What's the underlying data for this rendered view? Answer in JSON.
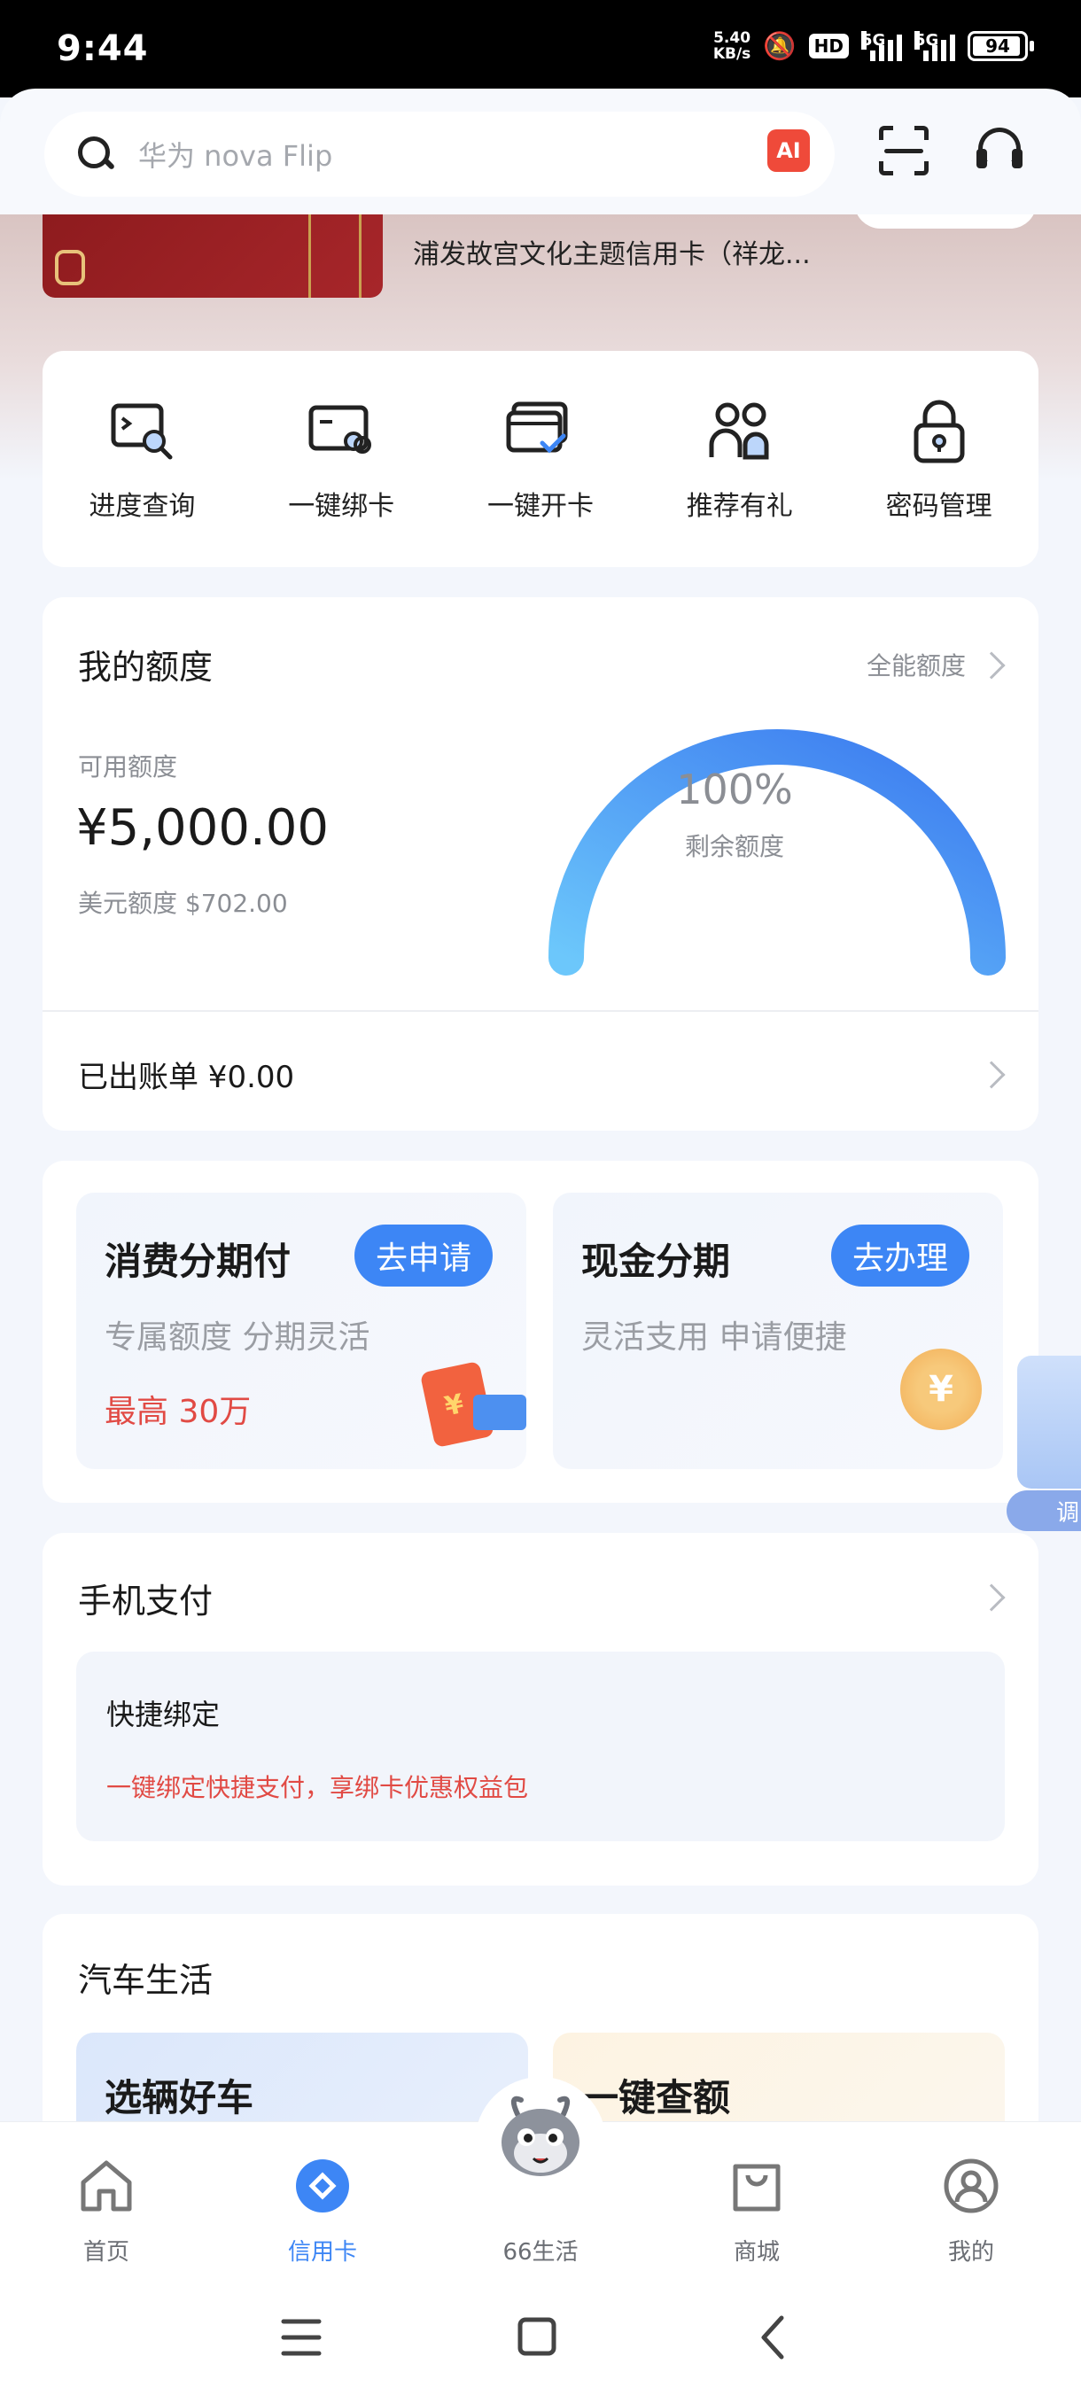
{
  "status": {
    "time": "9:44",
    "speed_value": "5.40",
    "speed_unit": "KB/s",
    "hd_label": "HD",
    "net1": "5G",
    "net2": "5G",
    "battery": "94",
    "battery_level": 0.94
  },
  "header": {
    "search_placeholder": "华为 nova Flip",
    "ai_label": "AI"
  },
  "banner": {
    "card_title": "浦发故宫文化主题信用卡（祥龙..."
  },
  "quick_actions": [
    {
      "label": "进度查询",
      "icon": "progress-search-icon"
    },
    {
      "label": "一键绑卡",
      "icon": "bind-card-icon"
    },
    {
      "label": "一键开卡",
      "icon": "activate-card-icon"
    },
    {
      "label": "推荐有礼",
      "icon": "refer-friends-icon"
    },
    {
      "label": "密码管理",
      "icon": "lock-icon"
    }
  ],
  "credit": {
    "title": "我的额度",
    "more_label": "全能额度",
    "available_label": "可用额度",
    "available_amount": "¥5,000.00",
    "usd_line": "美元额度 $702.00",
    "gauge_percent": "100%",
    "gauge_value": 1.0,
    "gauge_label": "剩余额度",
    "bill_line": "已出账单 ¥0.00"
  },
  "installments": [
    {
      "title": "消费分期付",
      "button": "去申请",
      "subtitle": "专属额度 分期灵活",
      "highlight": "最高 30万"
    },
    {
      "title": "现金分期",
      "button": "去办理",
      "subtitle": "灵活支用 申请便捷",
      "coin": "¥"
    }
  ],
  "float_widget": {
    "label": "调"
  },
  "mobile_pay": {
    "title": "手机支付",
    "box_title": "快捷绑定",
    "box_subtitle": "一键绑定快捷支付，享绑卡优惠权益包"
  },
  "car_life": {
    "title": "汽车生活",
    "cards": [
      "选辆好车",
      "一键查额"
    ]
  },
  "bottom_nav": [
    {
      "label": "首页",
      "icon": "home-icon",
      "active": false
    },
    {
      "label": "信用卡",
      "icon": "credit-card-icon",
      "active": true
    },
    {
      "label": "66生活",
      "icon": "dragon-mascot-icon",
      "active": false
    },
    {
      "label": "商城",
      "icon": "shopping-bag-icon",
      "active": false
    },
    {
      "label": "我的",
      "icon": "profile-icon",
      "active": false
    }
  ],
  "colors": {
    "accent": "#3d86f5",
    "warning_red": "#e14a44",
    "ai_badge": "#ef4a3a",
    "gauge_start": "#6cc7fb",
    "gauge_end": "#3a78ef"
  }
}
